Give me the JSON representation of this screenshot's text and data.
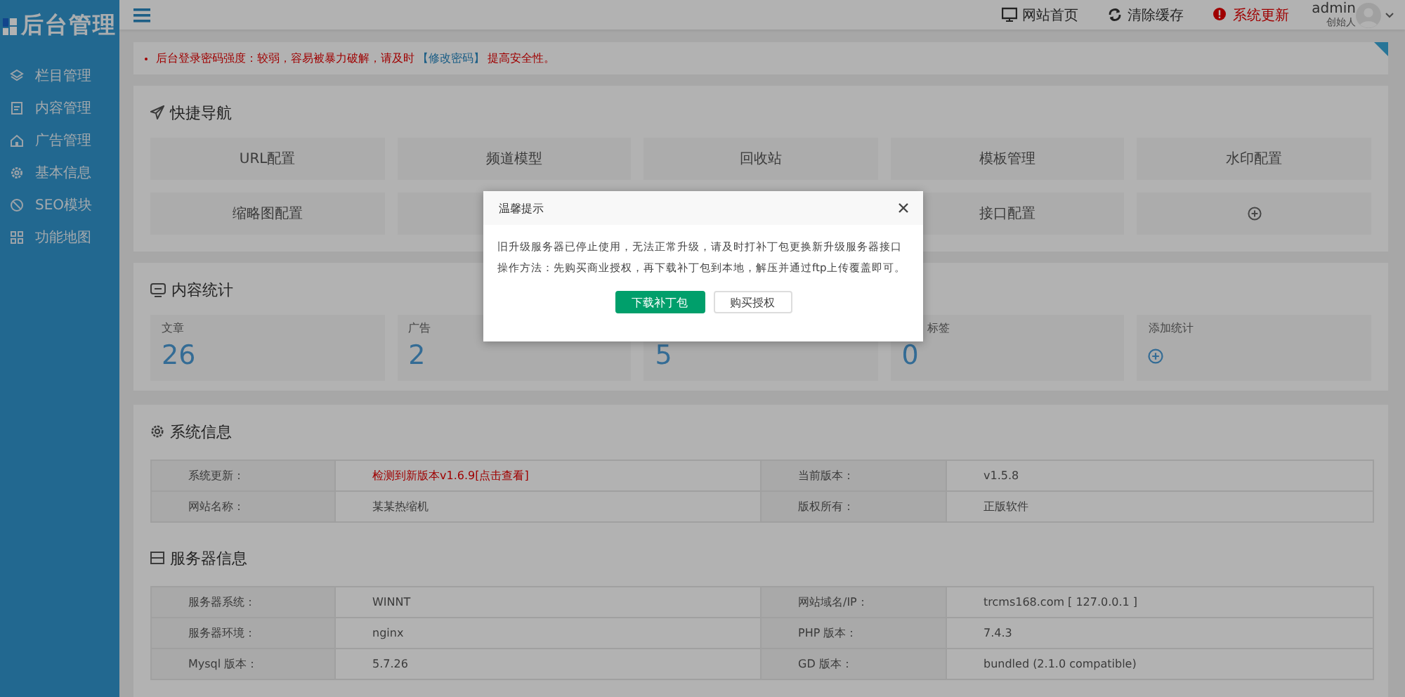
{
  "sidebar": {
    "logo": "后台管理",
    "items": [
      {
        "label": "栏目管理"
      },
      {
        "label": "内容管理"
      },
      {
        "label": "广告管理"
      },
      {
        "label": "基本信息"
      },
      {
        "label": "SEO模块"
      },
      {
        "label": "功能地图"
      }
    ]
  },
  "header": {
    "links": [
      {
        "label": "网站首页",
        "kind": "home"
      },
      {
        "label": "清除缓存",
        "kind": "refresh"
      },
      {
        "label": "系统更新",
        "kind": "alert"
      }
    ],
    "user": {
      "name": "admin",
      "role": "创始人"
    }
  },
  "notice": {
    "text": "后台登录密码强度：较弱，容易被暴力破解，请及时",
    "link": "【修改密码】",
    "after": "提高安全性。"
  },
  "quick_nav": {
    "title": "快捷导航",
    "items": [
      {
        "kind": "link",
        "label": "URL配置"
      },
      {
        "kind": "link",
        "label": "频道模型"
      },
      {
        "kind": "link",
        "label": "回收站"
      },
      {
        "kind": "link",
        "label": "模板管理"
      },
      {
        "kind": "link",
        "label": "水印配置"
      },
      {
        "kind": "link",
        "label": "缩略图配置"
      },
      {
        "kind": "covered"
      },
      {
        "kind": "link",
        "label": "接口配置"
      },
      {
        "kind": "add"
      }
    ]
  },
  "stats": {
    "title": "内容统计",
    "items": [
      {
        "kind": "count",
        "label": "文章",
        "value": "26"
      },
      {
        "kind": "count",
        "label": "广告",
        "value": "2"
      },
      {
        "kind": "count",
        "value": "5"
      },
      {
        "kind": "count_covered",
        "label": "标签",
        "value": "0"
      },
      {
        "kind": "add",
        "label": "添加统计"
      }
    ]
  },
  "sections": [
    {
      "title": "系统信息",
      "kind": "system",
      "rows": [
        [
          {
            "text": "系统更新：",
            "kind": "label"
          },
          {
            "text": "检测到新版本v1.6.9[点击查看]",
            "kind": "alert"
          },
          {
            "text": "当前版本：",
            "kind": "label"
          },
          {
            "text": "v1.5.8",
            "kind": "value"
          }
        ],
        [
          {
            "text": "网站名称：",
            "kind": "label"
          },
          {
            "text": "某某热缩机",
            "kind": "value"
          },
          {
            "text": "版权所有：",
            "kind": "label"
          },
          {
            "text": "正版软件",
            "kind": "value"
          }
        ]
      ]
    },
    {
      "title": "服务器信息",
      "kind": "server",
      "rows": [
        [
          {
            "text": "服务器系统：",
            "kind": "label"
          },
          {
            "text": "WINNT",
            "kind": "value"
          },
          {
            "text": "网站域名/IP：",
            "kind": "label"
          },
          {
            "text": "trcms168.com [ 127.0.0.1 ]",
            "kind": "value"
          }
        ],
        [
          {
            "text": "服务器环境：",
            "kind": "label"
          },
          {
            "text": "nginx",
            "kind": "value"
          },
          {
            "text": "PHP 版本：",
            "kind": "label"
          },
          {
            "text": "7.4.3",
            "kind": "value"
          }
        ],
        [
          {
            "text": "Mysql 版本：",
            "kind": "label"
          },
          {
            "text": "5.7.26",
            "kind": "value"
          },
          {
            "text": "GD 版本：",
            "kind": "label"
          },
          {
            "text": "bundled (2.1.0 compatible)",
            "kind": "value"
          }
        ]
      ]
    }
  ],
  "modal": {
    "title": "温馨提示",
    "lines": [
      "旧升级服务器已停止使用，无法正常升级，请及时打补丁包更换新升级服务器接口",
      "操作方法：先购买商业授权，再下载补丁包到本地，解压并通过ftp上传覆盖即可。"
    ],
    "buttons": [
      {
        "label": "下载补丁包",
        "kind": "primary"
      },
      {
        "label": "购买授权",
        "kind": "default"
      }
    ]
  }
}
